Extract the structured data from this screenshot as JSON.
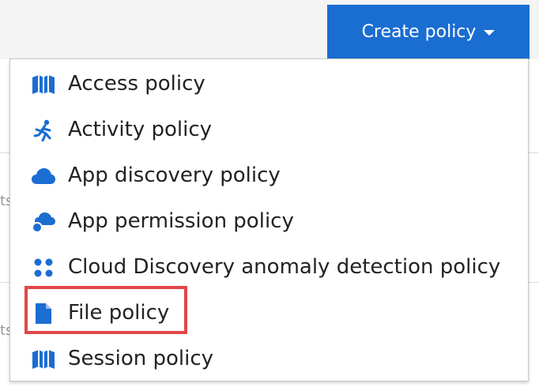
{
  "header": {
    "create_button_label": "Create policy",
    "accent_color": "#1a6dd1"
  },
  "background": {
    "fragment_1": "ts",
    "fragment_2": "ts"
  },
  "menu": {
    "items": [
      {
        "label": "Access policy",
        "icon": "map-icon"
      },
      {
        "label": "Activity policy",
        "icon": "running-person-icon"
      },
      {
        "label": "App discovery policy",
        "icon": "cloud-icon"
      },
      {
        "label": "App permission policy",
        "icon": "cloud-permission-icon"
      },
      {
        "label": "Cloud Discovery anomaly detection policy",
        "icon": "dots-grid-icon"
      },
      {
        "label": "File policy",
        "icon": "file-icon",
        "highlighted": true
      },
      {
        "label": "Session policy",
        "icon": "map-icon"
      }
    ],
    "icon_color": "#1a6dd1",
    "highlight_color": "#e04848"
  }
}
